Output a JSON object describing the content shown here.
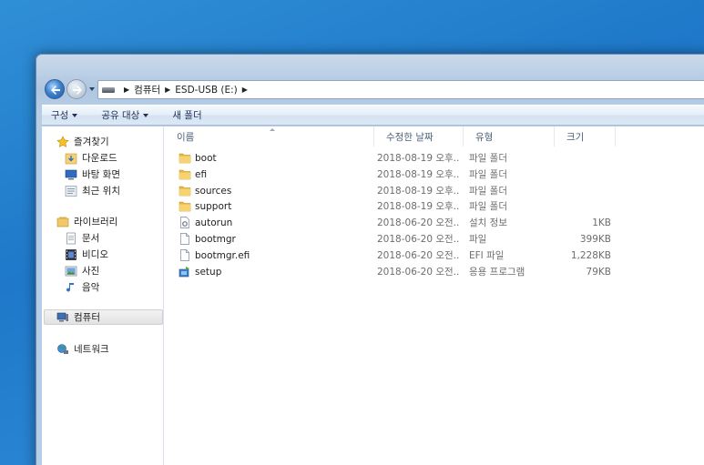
{
  "address": {
    "crumbs": [
      "컴퓨터",
      "ESD-USB (E:)"
    ]
  },
  "toolbar": {
    "organize": "구성",
    "share": "공유 대상",
    "new_folder": "새 폴더"
  },
  "sidebar": {
    "favorites": {
      "label": "즐겨찾기",
      "items": [
        "다운로드",
        "바탕 화면",
        "최근 위치"
      ]
    },
    "libraries": {
      "label": "라이브러리",
      "items": [
        "문서",
        "비디오",
        "사진",
        "음악"
      ]
    },
    "computer": "컴퓨터",
    "network": "네트워크"
  },
  "columns": {
    "name": "이름",
    "date": "수정한 날짜",
    "type": "유형",
    "size": "크기"
  },
  "files": [
    {
      "name": "boot",
      "date": "2018-08-19 오후...",
      "type": "파일 폴더",
      "size": "",
      "icon": "folder-icon"
    },
    {
      "name": "efi",
      "date": "2018-08-19 오후...",
      "type": "파일 폴더",
      "size": "",
      "icon": "folder-icon"
    },
    {
      "name": "sources",
      "date": "2018-08-19 오후...",
      "type": "파일 폴더",
      "size": "",
      "icon": "folder-icon"
    },
    {
      "name": "support",
      "date": "2018-08-19 오후...",
      "type": "파일 폴더",
      "size": "",
      "icon": "folder-icon"
    },
    {
      "name": "autorun",
      "date": "2018-06-20 오전...",
      "type": "설치 정보",
      "size": "1KB",
      "icon": "settings-file-icon"
    },
    {
      "name": "bootmgr",
      "date": "2018-06-20 오전...",
      "type": "파일",
      "size": "399KB",
      "icon": "file-icon"
    },
    {
      "name": "bootmgr.efi",
      "date": "2018-06-20 오전...",
      "type": "EFI 파일",
      "size": "1,228KB",
      "icon": "file-icon"
    },
    {
      "name": "setup",
      "date": "2018-06-20 오전...",
      "type": "응용 프로그램",
      "size": "79KB",
      "icon": "setup-app-icon"
    }
  ]
}
